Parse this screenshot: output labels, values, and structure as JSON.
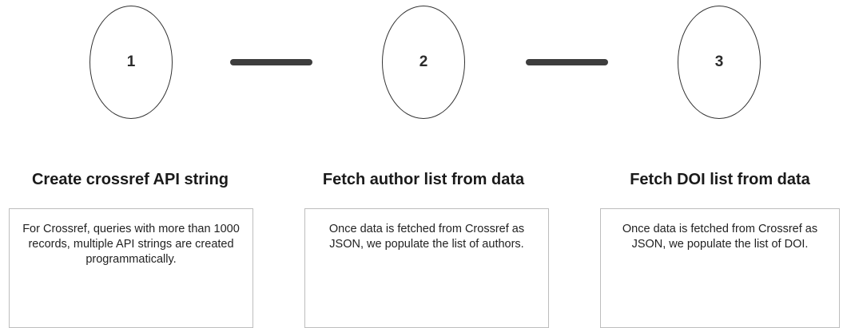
{
  "steps": [
    {
      "number": "1",
      "title": "Create crossref API string",
      "description": "For Crossref, queries with more than 1000 records, multiple API strings are created programmatically."
    },
    {
      "number": "2",
      "title": "Fetch author list from data",
      "description": "Once data is fetched from Crossref as JSON, we populate the list of authors."
    },
    {
      "number": "3",
      "title": "Fetch DOI list from data",
      "description": "Once data is fetched from Crossref as JSON, we populate the list of DOI."
    }
  ]
}
